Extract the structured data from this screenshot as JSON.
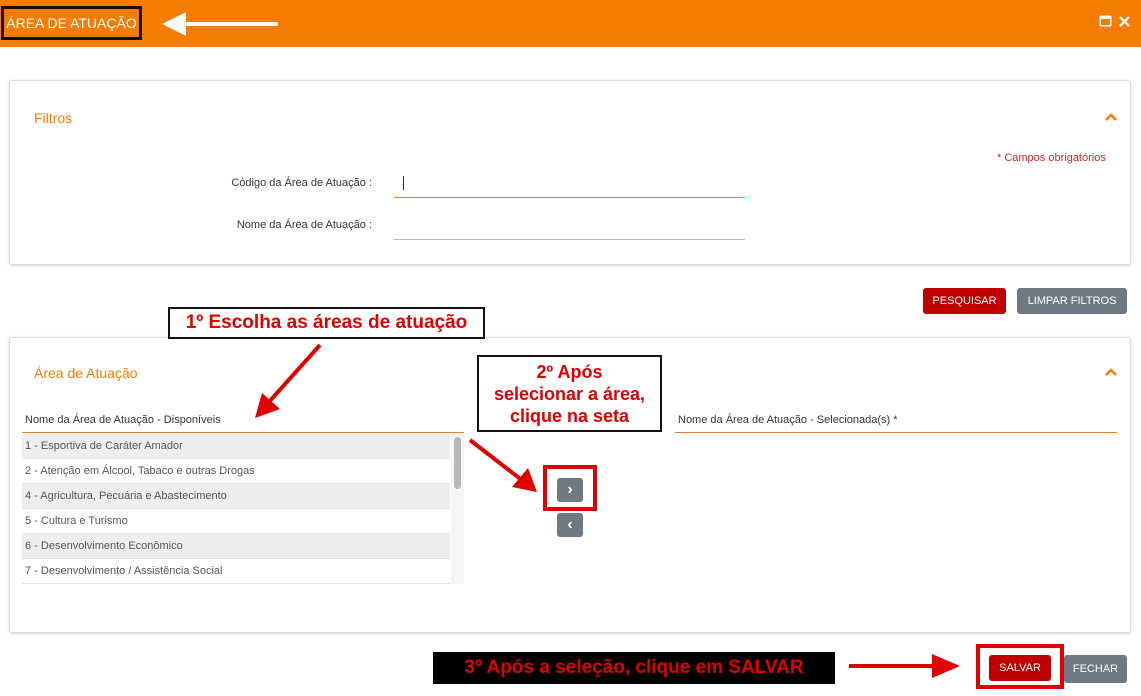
{
  "window": {
    "title": "ÁREA DE ATUAÇÃO",
    "icons": [
      "minimize-icon",
      "close-icon"
    ],
    "accent_color": "#f57c00"
  },
  "filters": {
    "title": "Filtros",
    "required_note": "* Campos obrigatórios",
    "code_label": "Código da Área de Atuação :",
    "code_value": "",
    "name_label": "Nome da Área de Atuação :",
    "name_value": ""
  },
  "buttons": {
    "search": "PESQUISAR",
    "clear": "LIMPAR FILTROS",
    "save": "SALVAR",
    "close": "FECHAR"
  },
  "area": {
    "title": "Área de Atuação",
    "available_header": "Nome da Área de Atuação - Disponíveis",
    "selected_header": "Nome da Área de Atuação - Selecionada(s) *",
    "available_items": [
      "1 - Esportiva de Caráter Amador",
      "2 - Atenção em Álcool, Tabaco e outras Drogas",
      "4 - Agricultura, Pecuária e Abastecimento",
      "5 - Cultura e Turismo",
      "6 - Desenvolvimento Econômico",
      "7 - Desenvolvimento / Assistência Social"
    ],
    "selected_items": [],
    "move_right_glyph": "›",
    "move_left_glyph": "‹"
  },
  "annotations": {
    "step1": "1º Escolha as áreas de atuação",
    "step2_lines": [
      "2º Após",
      "selecionar a área,",
      "clique na seta"
    ],
    "step3": "3º Após a seleção, clique em SALVAR"
  }
}
